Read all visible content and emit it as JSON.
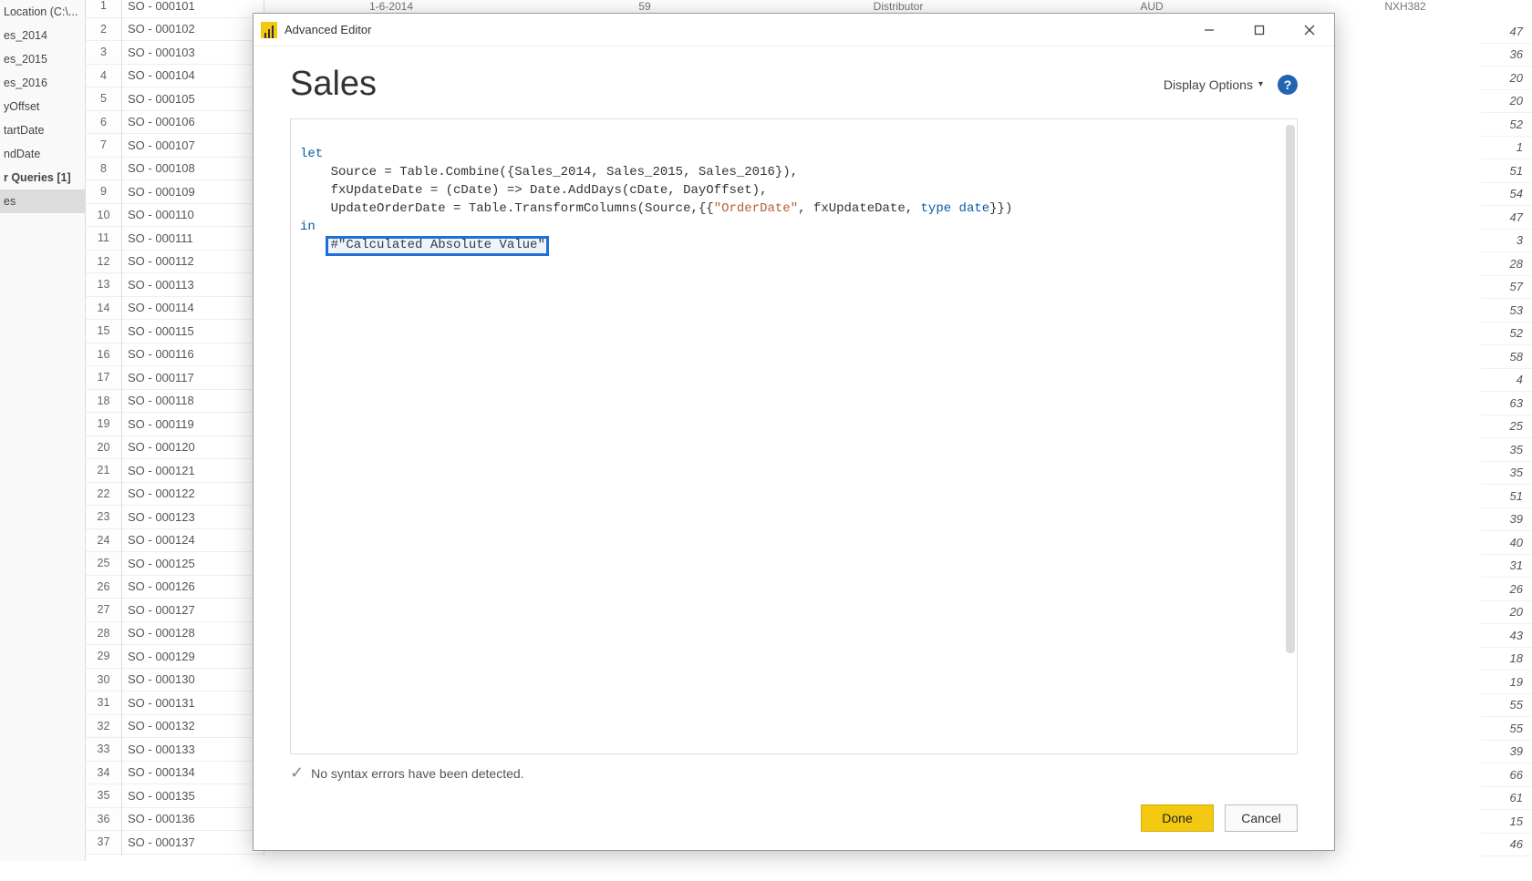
{
  "nav_items": [
    {
      "label": "Location (C:\\...",
      "sel": false
    },
    {
      "label": "es_2014",
      "sel": false
    },
    {
      "label": "es_2015",
      "sel": false
    },
    {
      "label": "es_2016",
      "sel": false
    },
    {
      "label": "yOffset",
      "sel": false
    },
    {
      "label": "tartDate",
      "sel": false
    },
    {
      "label": "ndDate",
      "sel": false
    },
    {
      "label": "r Queries [1]",
      "sel": false,
      "bold": true
    },
    {
      "label": "es",
      "sel": true
    }
  ],
  "row_count": 37,
  "so_values": [
    "SO - 000101",
    "SO - 000102",
    "SO - 000103",
    "SO - 000104",
    "SO - 000105",
    "SO - 000106",
    "SO - 000107",
    "SO - 000108",
    "SO - 000109",
    "SO - 000110",
    "SO - 000111",
    "SO - 000112",
    "SO - 000113",
    "SO - 000114",
    "SO - 000115",
    "SO - 000116",
    "SO - 000117",
    "SO - 000118",
    "SO - 000119",
    "SO - 000120",
    "SO - 000121",
    "SO - 000122",
    "SO - 000123",
    "SO - 000124",
    "SO - 000125",
    "SO - 000126",
    "SO - 000127",
    "SO - 000128",
    "SO - 000129",
    "SO - 000130",
    "SO - 000131",
    "SO - 000132",
    "SO - 000133",
    "SO - 000134",
    "SO - 000135",
    "SO - 000136",
    "SO - 000137"
  ],
  "right_values": [
    47,
    36,
    20,
    20,
    52,
    1,
    51,
    54,
    47,
    3,
    28,
    57,
    53,
    52,
    58,
    4,
    63,
    25,
    35,
    35,
    51,
    39,
    40,
    31,
    26,
    20,
    43,
    18,
    19,
    55,
    55,
    39,
    66,
    61,
    15,
    46
  ],
  "bg_header": {
    "date": "1-6-2014",
    "qty": "59",
    "channel": "Distributor",
    "currency": "AUD",
    "code": "NXH382"
  },
  "dialog": {
    "title": "Advanced Editor",
    "query_name": "Sales",
    "display_options_label": "Display Options",
    "code": {
      "let": "let",
      "line1_pre": "    Source = Table.Combine({Sales_2014, Sales_2015, Sales_2016}),",
      "line2_pre": "    fxUpdateDate = (cDate) => Date.AddDays(cDate, DayOffset),",
      "line3_a": "    UpdateOrderDate = Table.TransformColumns(Source,{{",
      "line3_str": "\"OrderDate\"",
      "line3_b": ", fxUpdateDate, ",
      "line3_type": "type ",
      "line3_date": "date",
      "line3_c": "}})",
      "in": "in",
      "line_out": "    #\"Calculated Absolute Value\""
    },
    "status_text": "No syntax errors have been detected.",
    "done_label": "Done",
    "cancel_label": "Cancel"
  }
}
